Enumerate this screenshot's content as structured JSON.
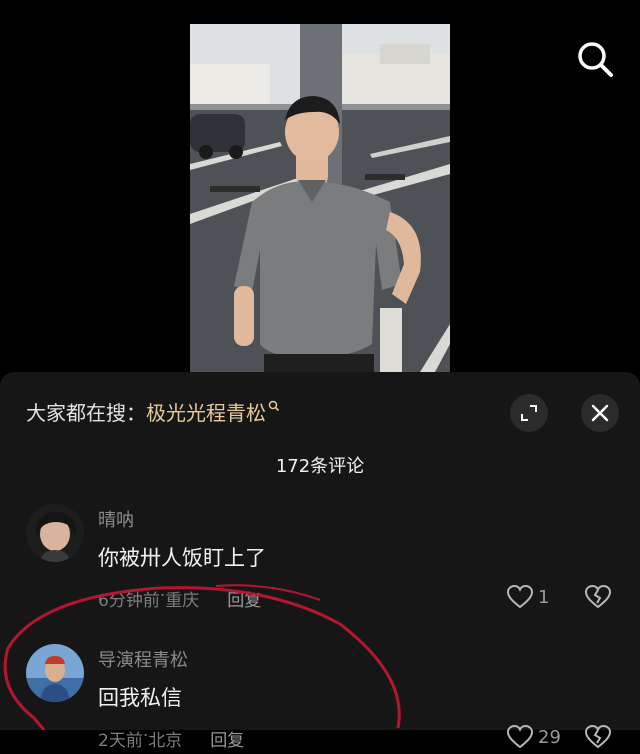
{
  "video": {
    "description_icon": "search-icon"
  },
  "sheet": {
    "hot_search_prefix": "大家都在搜：",
    "hot_search_term": "极光光程青松",
    "comment_count": "172条评论"
  },
  "comments": [
    {
      "user": "晴呐",
      "text": "你被卅人饭盯上了",
      "time": "6分钟前",
      "separator": " · ",
      "location": "重庆",
      "reply": "回复",
      "likes": "1"
    },
    {
      "user": "导演程青松",
      "text": "回我私信",
      "time": "2天前",
      "separator": " · ",
      "location": "北京",
      "reply": "回复",
      "likes": "29"
    }
  ],
  "colors": {
    "sheet_bg": "#161616",
    "hot_term": "#e9c99a",
    "annotation": "#b3172f"
  }
}
